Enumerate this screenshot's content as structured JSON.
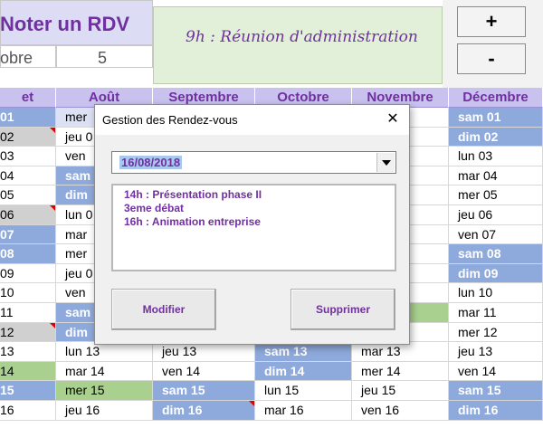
{
  "header": {
    "title": "Noter un RDV",
    "meeting_note": "9h : Réunion d'administration",
    "month_fragment": "obre",
    "day_value": "5",
    "plus_label": "+",
    "minus_label": "-"
  },
  "calendar": {
    "months": [
      "et",
      "Août",
      "Septembre",
      "Octobre",
      "Novembre",
      "Décembre"
    ],
    "rows": [
      [
        "01",
        "mer",
        "",
        "",
        "",
        "sam 01"
      ],
      [
        "02",
        "jeu 0",
        "",
        "",
        "",
        "dim 02"
      ],
      [
        "03",
        "ven",
        "",
        "",
        "",
        "lun 03"
      ],
      [
        "04",
        "sam",
        "",
        "",
        "",
        "mar 04"
      ],
      [
        "05",
        "dim",
        "",
        "",
        "",
        "mer 05"
      ],
      [
        "06",
        "lun 0",
        "",
        "",
        "",
        "jeu 06"
      ],
      [
        "07",
        "mar",
        "",
        "",
        "",
        "ven 07"
      ],
      [
        "08",
        "mer",
        "",
        "",
        "",
        "sam 08"
      ],
      [
        "09",
        "jeu 0",
        "",
        "",
        "",
        "dim 09"
      ],
      [
        "10",
        "ven",
        "",
        "",
        "",
        "lun 10"
      ],
      [
        "11",
        "sam",
        "",
        "",
        "",
        "mar 11"
      ],
      [
        "12",
        "dim",
        "",
        "",
        "",
        "mer 12"
      ],
      [
        "13",
        "lun 13",
        "jeu 13",
        "sam 13",
        "mar 13",
        "jeu 13"
      ],
      [
        "14",
        "mar 14",
        "ven 14",
        "dim 14",
        "mer 14",
        "ven 14"
      ],
      [
        "15",
        "mer 15",
        "sam 15",
        "lun 15",
        "jeu 15",
        "sam 15"
      ],
      [
        "16",
        "jeu 16",
        "dim 16",
        "mar 16",
        "ven 16",
        "dim 16"
      ]
    ]
  },
  "dialog": {
    "title": "Gestion des Rendez-vous",
    "close_label": "✕",
    "selected_date": "16/08/2018",
    "appointments": [
      "14h : Présentation phase II",
      "3eme débat",
      "16h : Animation entreprise"
    ],
    "modify_label": "Modifier",
    "delete_label": "Supprimer"
  }
}
